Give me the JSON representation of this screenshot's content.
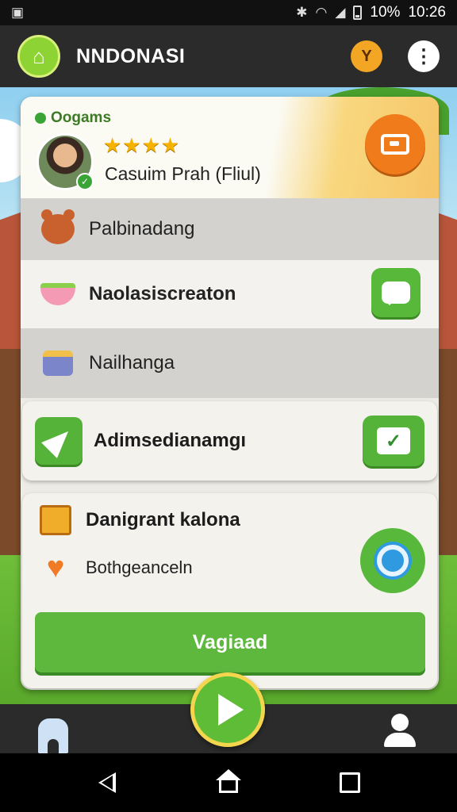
{
  "status_bar": {
    "battery": "10%",
    "time": "10:26"
  },
  "app_bar": {
    "title": "NNDONASI",
    "trophy_icon": "trophy-icon",
    "more_icon": "more-vert-icon"
  },
  "profile": {
    "heading": "Oogams",
    "rating": 4,
    "stars": "★★★★",
    "name": "Casuim Prah (Fliul)"
  },
  "menu": {
    "items": [
      {
        "label": "Palbinadang",
        "icon": "bear-icon"
      },
      {
        "label": "Naolasiscreaton",
        "icon": "bowl-icon"
      },
      {
        "label": "Nailhanga",
        "icon": "bag-icon"
      }
    ]
  },
  "task": {
    "label": "Adimsedianamgı"
  },
  "lower": {
    "row1_label": "Danigrant kalona",
    "row2_label": "Bothgeanceln",
    "primary_button": "Vagiaad"
  },
  "colors": {
    "green": "#5db83d",
    "orange": "#ef7b1a",
    "card": "#ecebe6"
  }
}
